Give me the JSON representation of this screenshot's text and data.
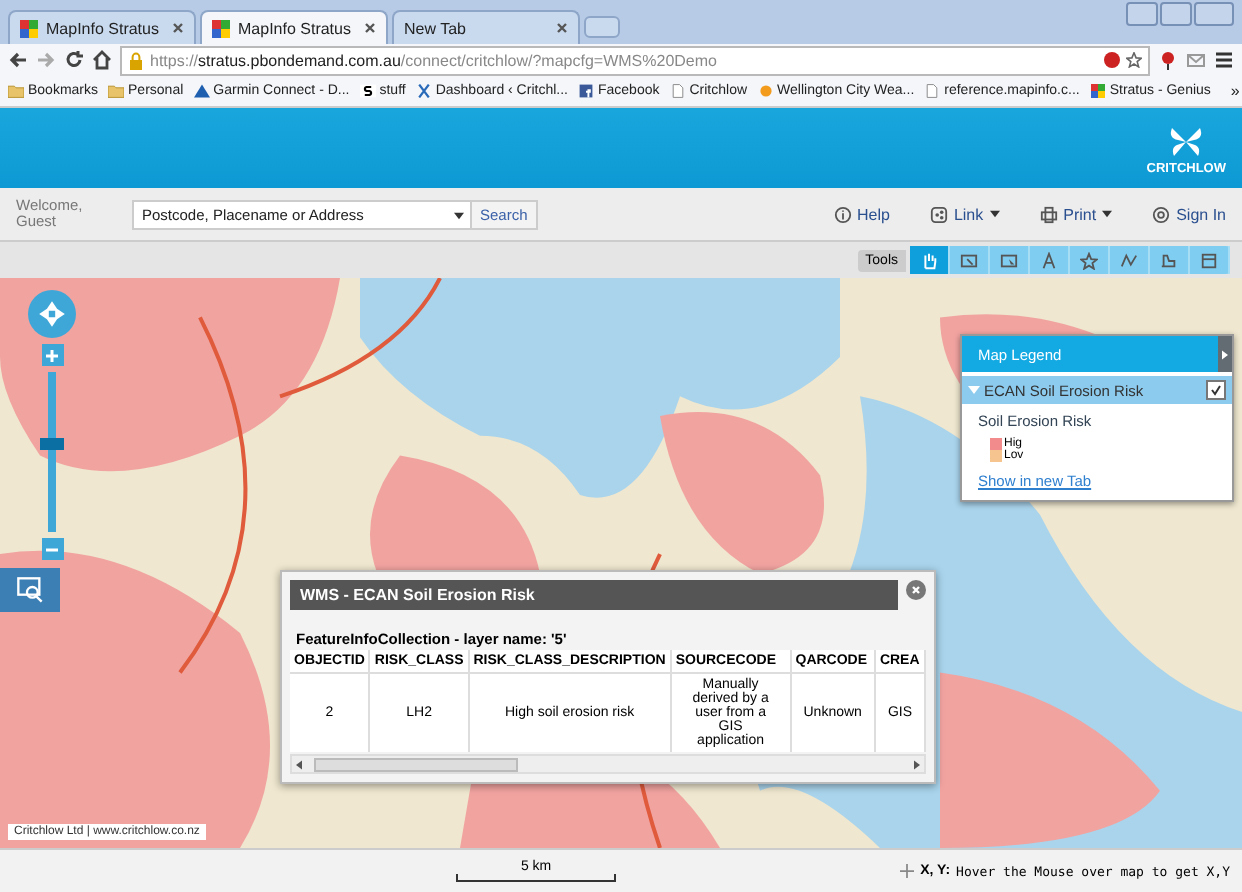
{
  "browser": {
    "tabs": [
      {
        "title": "MapInfo Stratus",
        "selected": false
      },
      {
        "title": "MapInfo Stratus",
        "selected": true
      },
      {
        "title": "New Tab",
        "selected": false
      }
    ],
    "url": {
      "scheme": "https://",
      "host": "stratus.pbondemand.com.au",
      "path": "/connect/critchlow/?mapcfg=WMS%20Demo"
    },
    "bookmarks": [
      {
        "label": "Bookmarks",
        "kind": "folder"
      },
      {
        "label": "Personal",
        "kind": "folder"
      },
      {
        "label": "Garmin Connect - D...",
        "kind": "triangle"
      },
      {
        "label": "stuff",
        "kind": "s"
      },
      {
        "label": "Dashboard ‹ Critchl...",
        "kind": "cross"
      },
      {
        "label": "Facebook",
        "kind": "f"
      },
      {
        "label": "Critchlow",
        "kind": "page"
      },
      {
        "label": "Wellington City Wea...",
        "kind": "sun"
      },
      {
        "label": "reference.mapinfo.c...",
        "kind": "page"
      },
      {
        "label": "Stratus - Genius",
        "kind": "tiles"
      }
    ],
    "overflow": "»"
  },
  "header": {
    "brand": "CRITCHLOW"
  },
  "toolbar": {
    "welcome": "Welcome,\nGuest",
    "search": {
      "placeholder": "Postcode, Placename or Address",
      "button": "Search"
    },
    "links": [
      {
        "label": "Help",
        "kind": "info",
        "dropdown": false
      },
      {
        "label": "Link",
        "kind": "share",
        "dropdown": true
      },
      {
        "label": "Print",
        "kind": "print",
        "dropdown": true
      },
      {
        "label": "Sign In",
        "kind": "gear",
        "dropdown": false
      }
    ]
  },
  "tools": {
    "label": "Tools",
    "buttons": [
      {
        "kind": "pan",
        "selected": true
      },
      {
        "kind": "info",
        "selected": false
      },
      {
        "kind": "select",
        "selected": false
      },
      {
        "kind": "text",
        "selected": false
      },
      {
        "kind": "star",
        "selected": false
      },
      {
        "kind": "line",
        "selected": false
      },
      {
        "kind": "measure",
        "selected": false
      },
      {
        "kind": "panel",
        "selected": false
      }
    ]
  },
  "zoom": {
    "level": 0.55
  },
  "legend": {
    "title": "Map Legend",
    "layer": {
      "name": "ECAN Soil Erosion Risk",
      "checked": true
    },
    "subtitle": "Soil Erosion Risk",
    "entries": [
      {
        "label": "Hig",
        "color": "#f28b8b"
      },
      {
        "label": "Lov",
        "color": "#f6c58f"
      }
    ],
    "link": "Show in new Tab"
  },
  "popup": {
    "title": "WMS - ECAN Soil Erosion Risk",
    "caption": "FeatureInfoCollection - layer name: '5'",
    "columns": [
      "OBJECTID",
      "RISK_CLASS",
      "RISK_CLASS_DESCRIPTION",
      "SOURCECODE",
      "QARCODE",
      "CREA"
    ],
    "rows": [
      [
        "2",
        "LH2",
        "High soil erosion risk",
        "Manually derived by a user from a GIS application",
        "Unknown",
        "GIS"
      ]
    ]
  },
  "attribution": "Critchlow Ltd | www.critchlow.co.nz",
  "scale": "5 km",
  "coords": {
    "label": "X, Y:",
    "text": "Hover the Mouse over map to get X,Y"
  }
}
